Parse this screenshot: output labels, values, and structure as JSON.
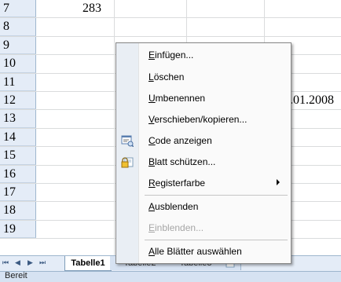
{
  "rows": [
    {
      "num": "7"
    },
    {
      "num": "8"
    },
    {
      "num": "9"
    },
    {
      "num": "10"
    },
    {
      "num": "11"
    },
    {
      "num": "12"
    },
    {
      "num": "13"
    },
    {
      "num": "14"
    },
    {
      "num": "15"
    },
    {
      "num": "16"
    },
    {
      "num": "17"
    },
    {
      "num": "18"
    },
    {
      "num": "19"
    }
  ],
  "cells": {
    "row7_value": "283",
    "row12_date_partial": ".01.2008"
  },
  "menu": {
    "items": [
      {
        "pre": "",
        "ul": "E",
        "post": "infügen...",
        "disabled": false
      },
      {
        "pre": "",
        "ul": "L",
        "post": "öschen",
        "disabled": false
      },
      {
        "pre": "",
        "ul": "U",
        "post": "mbenennen",
        "disabled": false
      },
      {
        "pre": "",
        "ul": "V",
        "post": "erschieben/kopieren...",
        "disabled": false
      },
      {
        "pre": "",
        "ul": "C",
        "post": "ode anzeigen",
        "disabled": false,
        "icon": "view-code-icon"
      },
      {
        "pre": "",
        "ul": "B",
        "post": "latt schützen...",
        "disabled": false,
        "icon": "protect-sheet-icon"
      },
      {
        "pre": "",
        "ul": "R",
        "post": "egisterfarbe",
        "disabled": false,
        "submenu": true
      },
      {
        "pre": "",
        "ul": "A",
        "post": "usblenden",
        "disabled": false
      },
      {
        "pre": "",
        "ul": "E",
        "post": "inblenden...",
        "disabled": true
      },
      {
        "pre": "",
        "ul": "A",
        "post": "lle Blätter auswählen",
        "disabled": false
      }
    ]
  },
  "sheet_tabs": [
    {
      "label": "Tabelle1",
      "active": true
    },
    {
      "label": "Tabelle2",
      "active": false
    },
    {
      "label": "Tabelle3",
      "active": false
    }
  ],
  "status": {
    "text": "Bereit"
  }
}
